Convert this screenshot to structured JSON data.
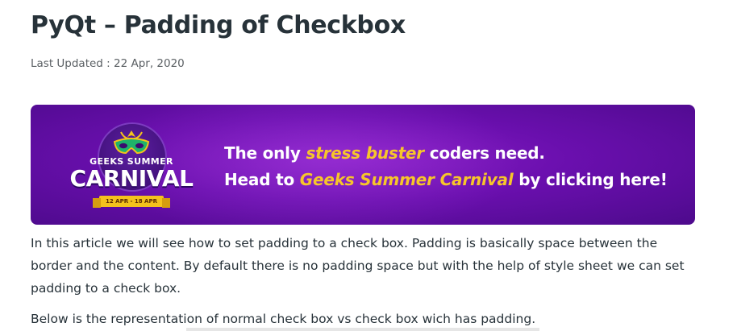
{
  "article": {
    "title": "PyQt – Padding of Checkbox",
    "last_updated": "Last Updated : 22 Apr, 2020"
  },
  "banner": {
    "logo_line1": "GEEKS SUMMER",
    "logo_line2": "CARNIVAL",
    "logo_dates": "12 APR - 18 APR",
    "line1_before": "The only ",
    "line1_highlight": "stress buster",
    "line1_after": " coders need.",
    "line2_before": "Head to ",
    "line2_highlight": "Geeks Summer Carnival",
    "line2_after": " by clicking here!",
    "accent_color": "#f7c62a",
    "background_color": "#6a0fae"
  },
  "body": {
    "paragraph1": "In this article we will see how to set padding to a check box. Padding is basically space between the border and the content. By default there is no padding space but with the help of style sheet we can set padding to a check box.",
    "paragraph2": "Below is the representation of normal check box vs check box wich has padding."
  }
}
